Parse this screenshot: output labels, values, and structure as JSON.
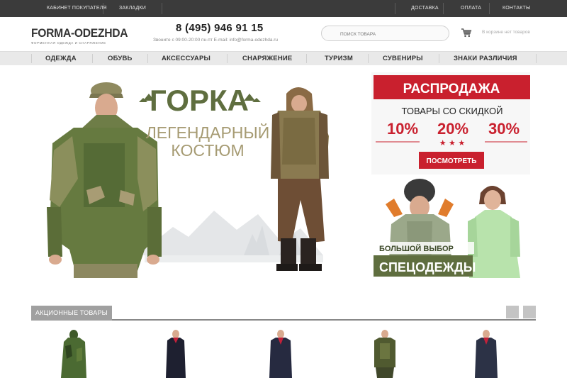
{
  "topbar": {
    "cabinet": "Кабинет покупателя",
    "bookmarks": "Закладки",
    "delivery": "Доставка",
    "payment": "Оплата",
    "contacts": "Контакты"
  },
  "header": {
    "logo_name": "FORMA-ODEZHDA",
    "logo_tagline": "ФОРМЕННАЯ ОДЕЖДА И СНАРЯЖЕНИЕ",
    "phone": "8 (495) 946 91 15",
    "hours": "Звоните с 09:00-20:00 пн-пт E-mail: info@forma-odezhda.ru",
    "search_placeholder": "ПОИСК ТОВАРА",
    "cart_text": "В корзине нет товаров"
  },
  "nav": {
    "items": [
      "ОДЕЖДА",
      "ОБУВЬ",
      "АКСЕССУАРЫ",
      "СНАРЯЖЕНИЕ",
      "ТУРИЗМ",
      "СУВЕНИРЫ",
      "ЗНАКИ РАЗЛИЧИЯ"
    ]
  },
  "hero": {
    "main_title": "ГОРКА",
    "main_subtitle_1": "ЛЕГЕНДАРНЫЙ",
    "main_subtitle_2": "КОСТЮМ",
    "sale_title": "РАСПРОДАЖА",
    "sale_subtitle": "ТОВАРЫ СО СКИДКОЙ",
    "discounts": [
      "10%",
      "20%",
      "30%"
    ],
    "sale_button": "ПОСМОТРЕТЬ",
    "work_line1": "БОЛЬШОЙ ВЫБОР",
    "work_line2": "СПЕЦОДЕЖДЫ"
  },
  "promo": {
    "title": "АКЦИОННЫЕ ТОВАРЫ"
  },
  "colors": {
    "topbar": "#3b3b3b",
    "accent_red": "#d41f34",
    "gorka_green": "#5f6e3f",
    "sale_red": "#c9202e"
  }
}
